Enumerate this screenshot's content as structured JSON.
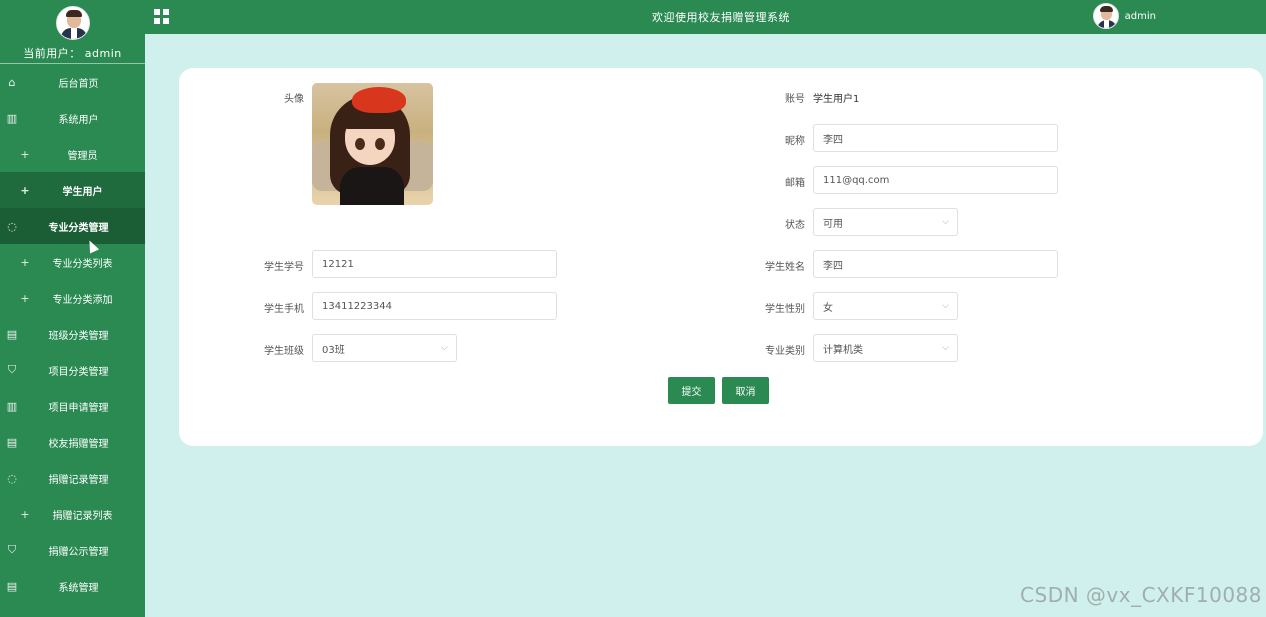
{
  "sidebar": {
    "user_label": "当前用户： admin",
    "items": [
      {
        "label": "后台首页",
        "icon": "⌂"
      },
      {
        "label": "系统用户",
        "icon": "▥"
      },
      {
        "label": "管理员",
        "icon": "+"
      },
      {
        "label": "学生用户",
        "icon": "+"
      },
      {
        "label": "专业分类管理",
        "icon": "◌"
      },
      {
        "label": "专业分类列表",
        "icon": "+"
      },
      {
        "label": "专业分类添加",
        "icon": "+"
      },
      {
        "label": "班级分类管理",
        "icon": "▤"
      },
      {
        "label": "项目分类管理",
        "icon": "⛉"
      },
      {
        "label": "项目申请管理",
        "icon": "▥"
      },
      {
        "label": "校友捐赠管理",
        "icon": "▤"
      },
      {
        "label": "捐赠记录管理",
        "icon": "◌"
      },
      {
        "label": "捐赠记录列表",
        "icon": "+"
      },
      {
        "label": "捐赠公示管理",
        "icon": "⛉"
      },
      {
        "label": "系统管理",
        "icon": "▤"
      }
    ]
  },
  "header": {
    "title": "欢迎使用校友捐赠管理系统",
    "username": "admin"
  },
  "form": {
    "avatar_label": "头像",
    "account_label": "账号",
    "account_value": "学生用户1",
    "nickname_label": "昵称",
    "nickname_value": "李四",
    "email_label": "邮箱",
    "email_value": "111@qq.com",
    "status_label": "状态",
    "status_value": "可用",
    "student_no_label": "学生学号",
    "student_no_value": "12121",
    "student_name_label": "学生姓名",
    "student_name_value": "李四",
    "phone_label": "学生手机",
    "phone_value": "13411223344",
    "gender_label": "学生性别",
    "gender_value": "女",
    "class_label": "学生班级",
    "class_value": "03班",
    "major_label": "专业类别",
    "major_value": "计算机类",
    "submit_label": "提交",
    "cancel_label": "取消"
  },
  "watermark": "CSDN @vx_CXKF10088",
  "colors": {
    "primary": "#2a8a52",
    "background": "#d0f0ee",
    "active": "#1f6b3d"
  }
}
